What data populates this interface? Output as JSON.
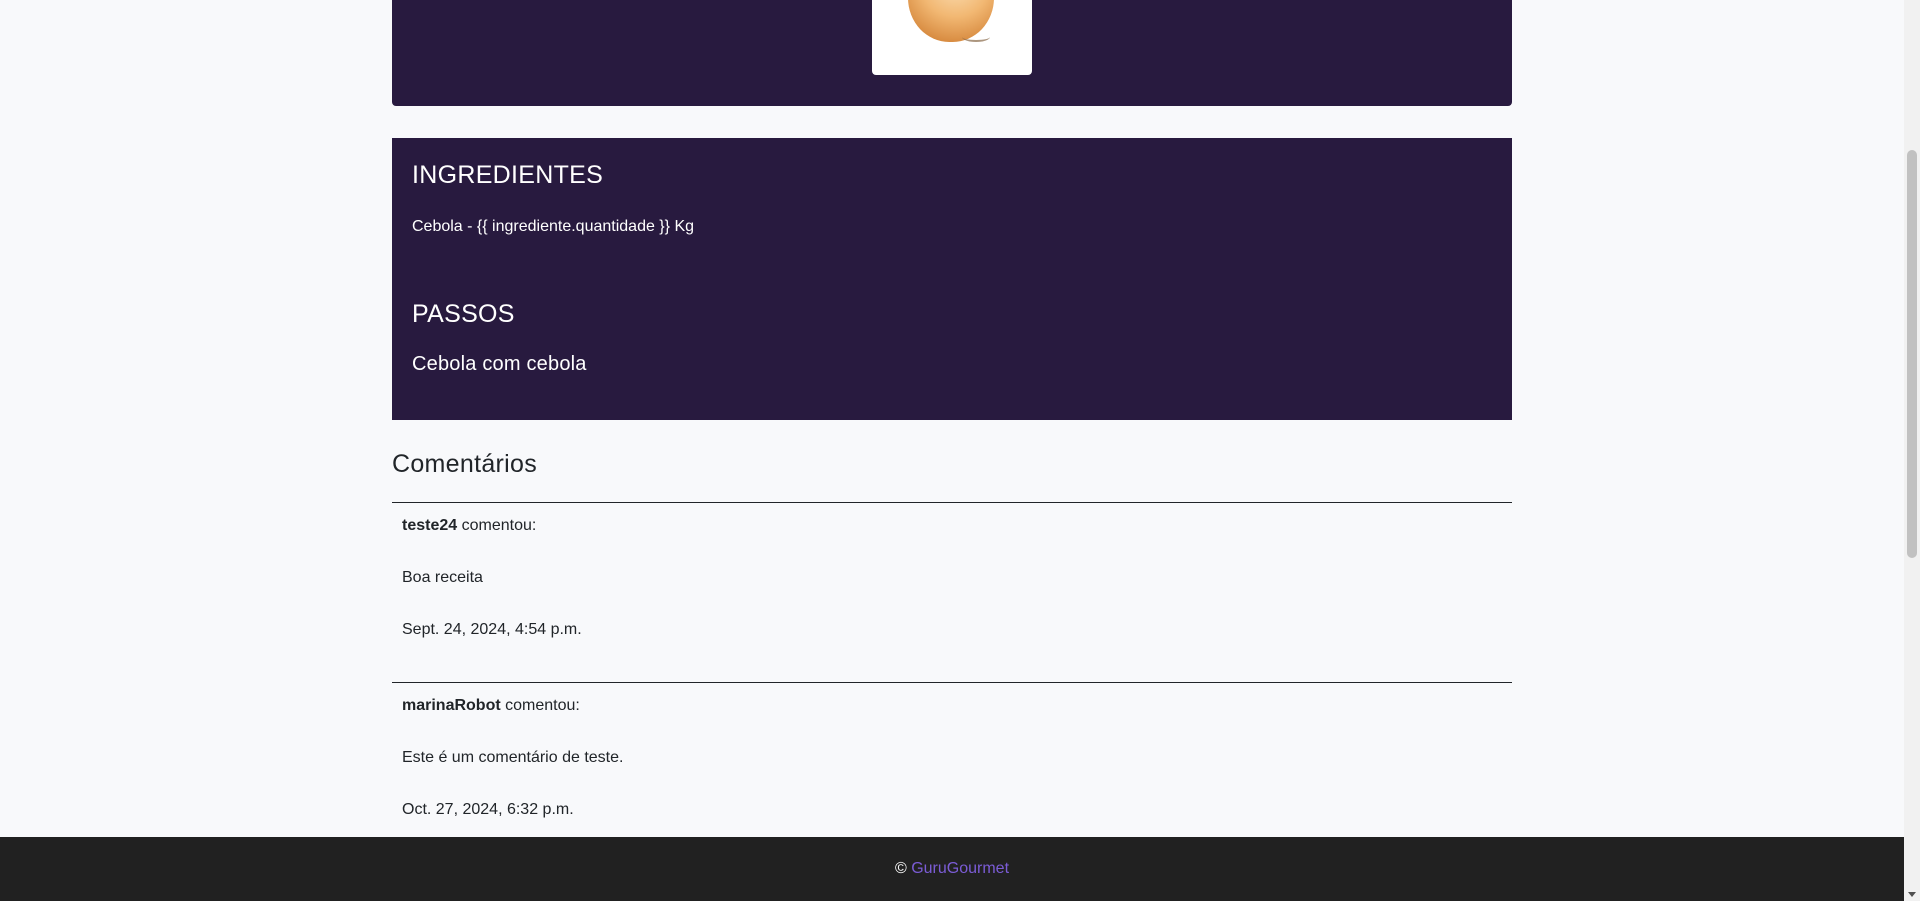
{
  "hero": {
    "image_icon": "onion-image"
  },
  "recipe": {
    "ingredients_title": "INGREDIENTES",
    "ingredient_line": "Cebola - {{ ingrediente.quantidade }} Kg",
    "steps_title": "PASSOS",
    "steps_text": "Cebola com cebola"
  },
  "comments": {
    "title": "Comentários",
    "items": [
      {
        "author": "teste24",
        "verb": " comentou:",
        "text": "Boa receita",
        "date": "Sept. 24, 2024, 4:54 p.m."
      },
      {
        "author": "marinaRobot",
        "verb": " comentou:",
        "text": "Este é um comentário de teste.",
        "date": "Oct. 27, 2024, 6:32 p.m."
      }
    ]
  },
  "footer": {
    "copyright": "© ",
    "brand": "GuruGourmet"
  },
  "colors": {
    "card_bg": "#281a3f",
    "page_bg": "#f8f9fb",
    "footer_bg": "#212121",
    "brand_link": "#7b5cd6"
  }
}
